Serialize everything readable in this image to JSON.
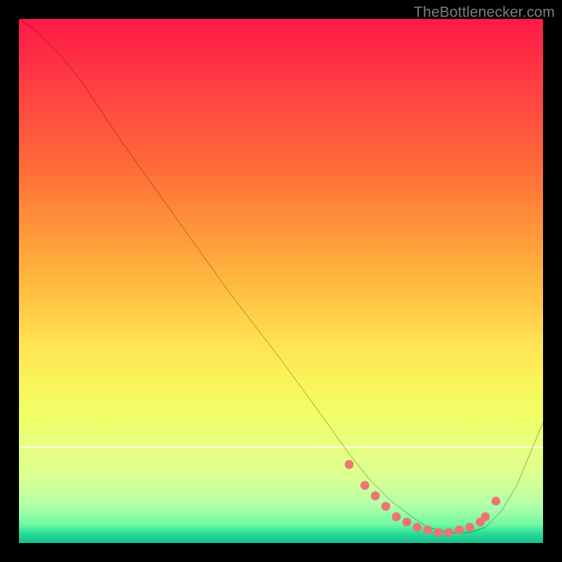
{
  "watermark": "TheBottlenecker.com",
  "chart_data": {
    "type": "line",
    "title": "",
    "xlabel": "",
    "ylabel": "",
    "xlim": [
      0,
      100
    ],
    "ylim": [
      0,
      100
    ],
    "series": [
      {
        "name": "curve",
        "x": [
          0,
          3,
          8,
          12,
          20,
          30,
          40,
          50,
          58,
          63,
          67,
          71,
          75,
          78,
          82,
          86,
          89,
          92,
          95,
          100
        ],
        "y": [
          100,
          98,
          93,
          88,
          76,
          62,
          48,
          35,
          24,
          17,
          12,
          8,
          5,
          3,
          2,
          2,
          3,
          6,
          11,
          23
        ]
      }
    ],
    "markers": {
      "name": "dots",
      "x": [
        63,
        66,
        68,
        70,
        72,
        74,
        76,
        78,
        80,
        82,
        84,
        86,
        88,
        89,
        91
      ],
      "y": [
        15,
        11,
        9,
        7,
        5,
        4,
        3,
        2.5,
        2,
        2,
        2.5,
        3,
        4,
        5,
        8
      ]
    },
    "colors": {
      "line": "#000000",
      "marker": "#ed7474"
    }
  }
}
